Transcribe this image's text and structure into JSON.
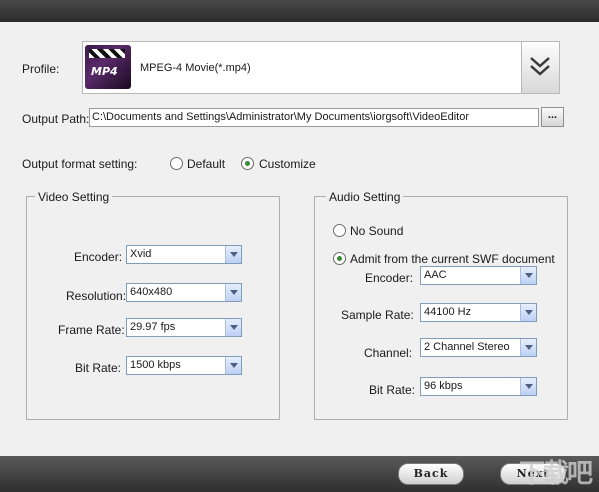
{
  "profile": {
    "label": "Profile:",
    "value": "MPEG-4 Movie(*.mp4)",
    "icon_text": "MP4"
  },
  "output_path": {
    "label": "Output Path:",
    "value": "C:\\Documents and Settings\\Administrator\\My Documents\\iorgsoft\\VideoEditor",
    "browse_label": "..."
  },
  "format_setting": {
    "label": "Output format setting:",
    "default_label": "Default",
    "customize_label": "Customize",
    "selected": "customize"
  },
  "video": {
    "title": "Video Setting",
    "encoder_label": "Encoder:",
    "encoder_value": "Xvid",
    "resolution_label": "Resolution:",
    "resolution_value": "640x480",
    "framerate_label": "Frame Rate:",
    "framerate_value": "29.97 fps",
    "bitrate_label": "Bit Rate:",
    "bitrate_value": "1500 kbps"
  },
  "audio": {
    "title": "Audio Setting",
    "no_sound_label": "No Sound",
    "admit_label": "Admit from the current SWF document",
    "selected": "admit",
    "encoder_label": "Encoder:",
    "encoder_value": "AAC",
    "samplerate_label": "Sample Rate:",
    "samplerate_value": "44100 Hz",
    "channel_label": "Channel:",
    "channel_value": "2 Channel Stereo",
    "bitrate_label": "Bit Rate:",
    "bitrate_value": "96 kbps"
  },
  "nav": {
    "back_label": "Back",
    "next_label": "Next"
  },
  "watermark": "下载吧"
}
